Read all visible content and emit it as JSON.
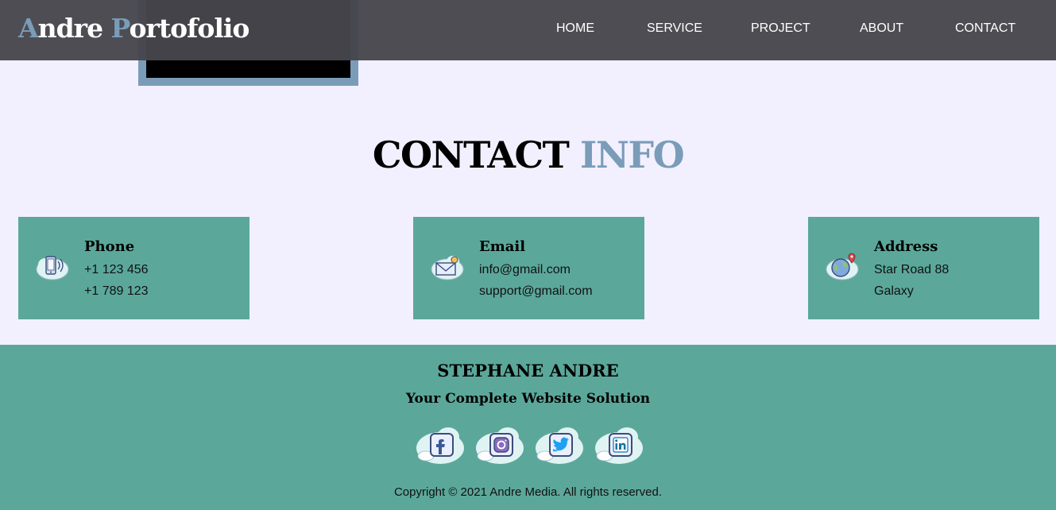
{
  "header": {
    "brand_first_initial": "A",
    "brand_first_rest": "ndre ",
    "brand_second_initial": "P",
    "brand_second_rest": "ortofolio",
    "nav": [
      {
        "label": "HOME"
      },
      {
        "label": "SERVICE"
      },
      {
        "label": "PROJECT"
      },
      {
        "label": "ABOUT"
      },
      {
        "label": "CONTACT"
      }
    ]
  },
  "contact": {
    "title_main": "CONTACT",
    "title_accent": "INFO",
    "cards": [
      {
        "icon": "phone-icon",
        "title": "Phone",
        "line1": "+1 123 456",
        "line2": "+1 789 123"
      },
      {
        "icon": "email-icon",
        "title": "Email",
        "line1": "info@gmail.com",
        "line2": "support@gmail.com"
      },
      {
        "icon": "location-globe-icon",
        "title": "Address",
        "line1": "Star Road 88",
        "line2": "Galaxy"
      }
    ]
  },
  "footer": {
    "name": "STEPHANE ANDRE",
    "tagline": "Your Complete Website Solution",
    "social": [
      {
        "icon": "facebook-icon"
      },
      {
        "icon": "instagram-icon"
      },
      {
        "icon": "twitter-icon"
      },
      {
        "icon": "linkedin-icon"
      }
    ],
    "copyright": "Copyright © 2021 Andre Media. All rights reserved."
  },
  "colors": {
    "navbar": "#46464c",
    "accent": "#7a9cb8",
    "teal": "#5ba89b",
    "background": "#f2f0fe"
  }
}
